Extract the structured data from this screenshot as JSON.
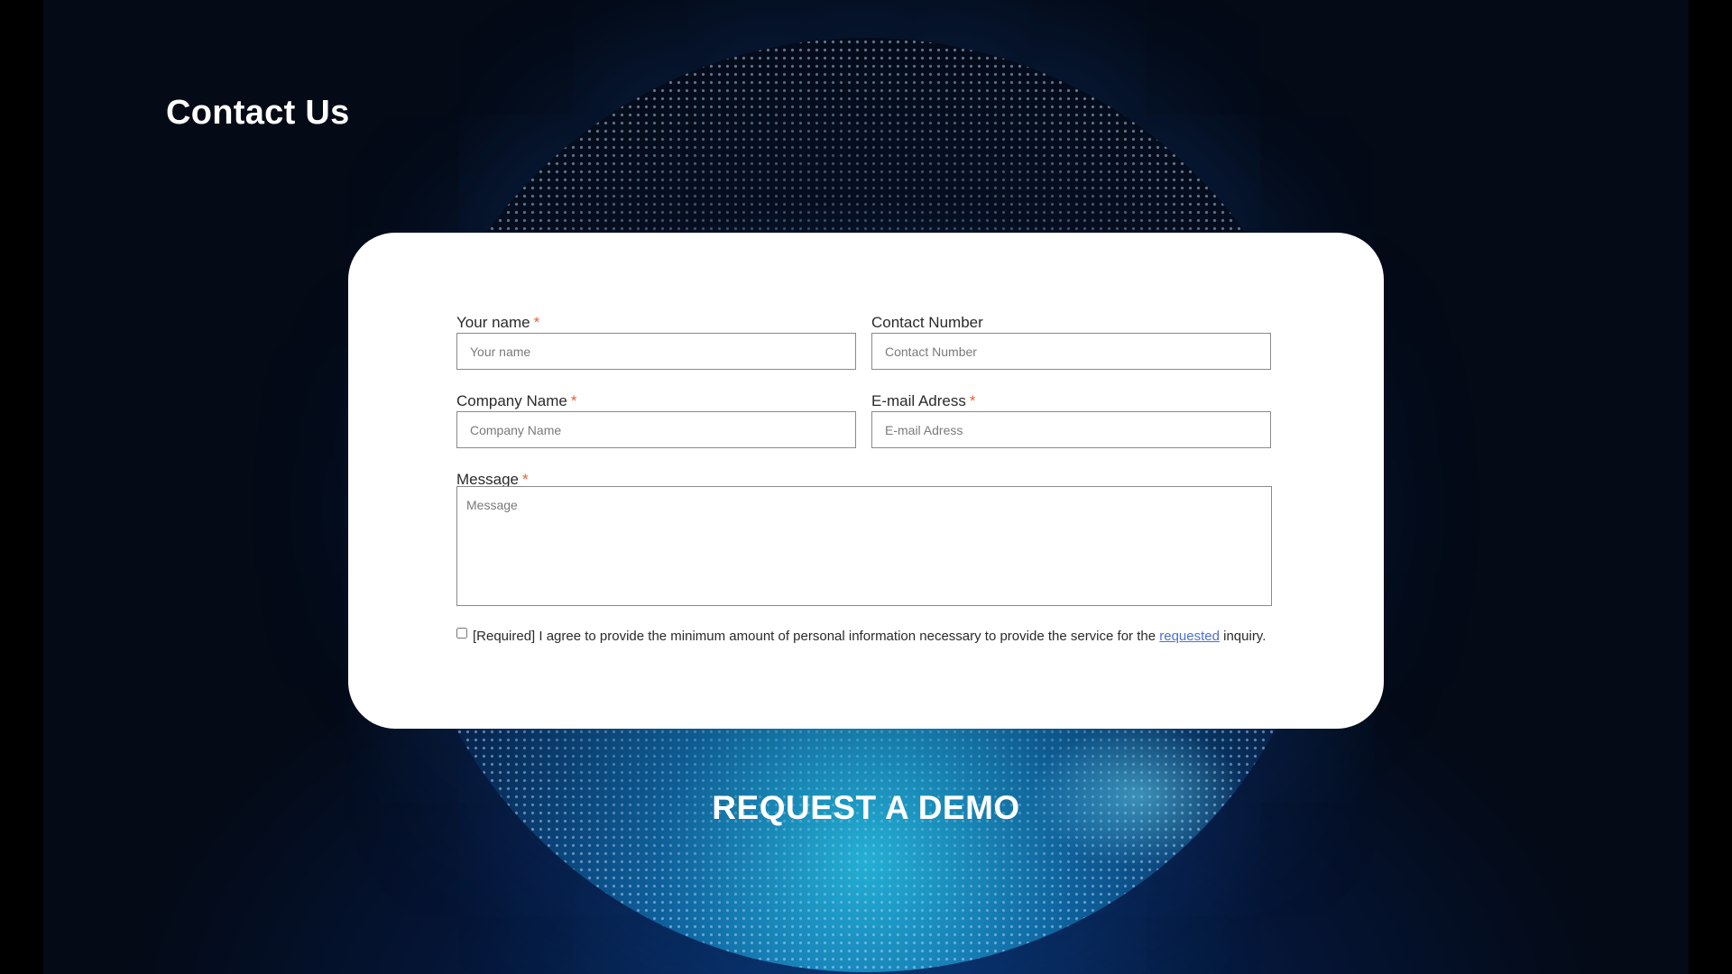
{
  "page": {
    "title": "Contact Us"
  },
  "form": {
    "your_name": {
      "label": "Your name",
      "required_mark": "*",
      "placeholder": "Your name",
      "value": ""
    },
    "contact_number": {
      "label": "Contact Number",
      "placeholder": "Contact Number",
      "value": ""
    },
    "company_name": {
      "label": "Company Name",
      "required_mark": "*",
      "placeholder": "Company Name",
      "value": ""
    },
    "email": {
      "label": "E-mail Adress",
      "required_mark": "*",
      "placeholder": "E-mail Adress",
      "value": ""
    },
    "message": {
      "label": "Message",
      "required_mark": "*",
      "placeholder": "Message",
      "value": ""
    },
    "consent": {
      "checked": false,
      "text_before": "[Required] I agree to provide the minimum amount of personal information necessary to provide the service for the ",
      "link_text": "requested",
      "text_after": " inquiry."
    }
  },
  "cta": {
    "label": "REQUEST A DEMO"
  },
  "colors": {
    "background": "#040a16",
    "card": "#ffffff",
    "required_mark": "#e8603c",
    "link": "#4a6fd8",
    "sphere_glow": "#28c8eb"
  }
}
